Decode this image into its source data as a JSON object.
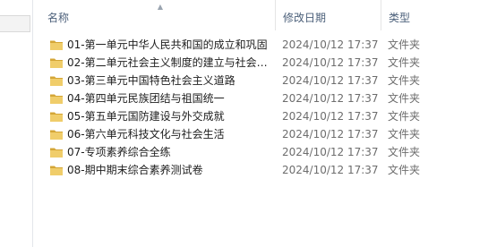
{
  "columns": {
    "name": "名称",
    "date": "修改日期",
    "type": "类型"
  },
  "sort": {
    "icon": "sort-ascending-icon"
  },
  "rows": [
    {
      "name": "01-第一单元中华人民共和国的成立和巩固",
      "date": "2024/10/12 17:37",
      "type": "文件夹"
    },
    {
      "name": "02-第二单元社会主义制度的建立与社会…",
      "date": "2024/10/12 17:37",
      "type": "文件夹"
    },
    {
      "name": "03-第三单元中国特色社会主义道路",
      "date": "2024/10/12 17:37",
      "type": "文件夹"
    },
    {
      "name": "04-第四单元民族团结与祖国统一",
      "date": "2024/10/12 17:37",
      "type": "文件夹"
    },
    {
      "name": "05-第五单元国防建设与外交成就",
      "date": "2024/10/12 17:37",
      "type": "文件夹"
    },
    {
      "name": "06-第六单元科技文化与社会生活",
      "date": "2024/10/12 17:37",
      "type": "文件夹"
    },
    {
      "name": "07-专项素养综合全练",
      "date": "2024/10/12 17:37",
      "type": "文件夹"
    },
    {
      "name": "08-期中期末综合素养测试卷",
      "date": "2024/10/12 17:37",
      "type": "文件夹"
    }
  ],
  "colors": {
    "folder": "#e8c15a",
    "folder_dark": "#d4a637",
    "header_text": "#4c607a"
  }
}
